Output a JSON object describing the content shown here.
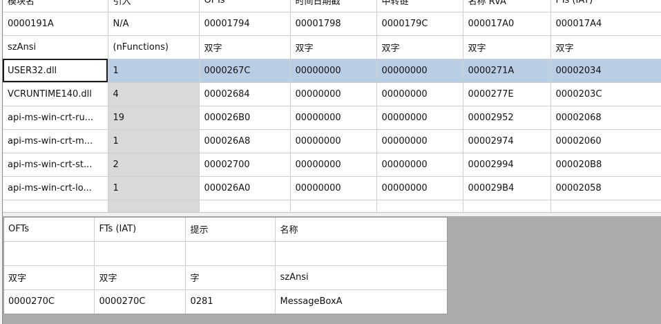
{
  "modules": {
    "headers": [
      "模块名",
      "引入",
      "OFTs",
      "时间日期戳",
      "中转链",
      "名称 RVA",
      "FTs (IAT)"
    ],
    "offsets": [
      "0000191A",
      "N/A",
      "00001794",
      "00001798",
      "0000179C",
      "000017A0",
      "000017A4"
    ],
    "sizes": [
      "szAnsi",
      "(nFunctions)",
      "双字",
      "双字",
      "双字",
      "双字",
      "双字"
    ],
    "rows": [
      [
        "USER32.dll",
        "1",
        "0000267C",
        "00000000",
        "00000000",
        "0000271A",
        "00002034"
      ],
      [
        "VCRUNTIME140.dll",
        "4",
        "00002684",
        "00000000",
        "00000000",
        "0000277E",
        "0000203C"
      ],
      [
        "api-ms-win-crt-ru...",
        "19",
        "000026B0",
        "00000000",
        "00000000",
        "00002952",
        "00002068"
      ],
      [
        "api-ms-win-crt-m...",
        "1",
        "000026A8",
        "00000000",
        "00000000",
        "00002974",
        "00002060"
      ],
      [
        "api-ms-win-crt-st...",
        "2",
        "00002700",
        "00000000",
        "00000000",
        "00002994",
        "000020B8"
      ],
      [
        "api-ms-win-crt-lo...",
        "1",
        "000026A0",
        "00000000",
        "00000000",
        "000029B4",
        "00002058"
      ]
    ],
    "selected_row": 0
  },
  "functions": {
    "headers": [
      "OFTs",
      "FTs (IAT)",
      "提示",
      "名称"
    ],
    "offsets": [
      "",
      "",
      "",
      ""
    ],
    "sizes": [
      "双字",
      "双字",
      "字",
      "szAnsi"
    ],
    "rows": [
      [
        "0000270C",
        "0000270C",
        "0281",
        "MessageBoxA"
      ]
    ]
  },
  "colors": {
    "selected_row": "#b9cde5",
    "gray_cell": "#d9d9d9",
    "background": "#ababab"
  }
}
